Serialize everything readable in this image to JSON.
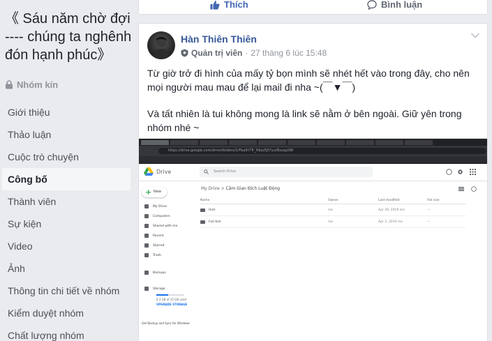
{
  "sidebar": {
    "group_title": "《 Sáu năm chờ đợi ---- chúng ta nghênh đón hạnh phúc》",
    "privacy": "Nhóm kín",
    "nav": [
      {
        "label": "Giới thiệu",
        "active": false
      },
      {
        "label": "Thảo luận",
        "active": false
      },
      {
        "label": "Cuộc trò chuyện",
        "active": false
      },
      {
        "label": "Công bố",
        "active": true
      },
      {
        "label": "Thành viên",
        "active": false
      },
      {
        "label": "Sự kiện",
        "active": false
      },
      {
        "label": "Video",
        "active": false
      },
      {
        "label": "Ảnh",
        "active": false
      },
      {
        "label": "Thông tin chi tiết về nhóm",
        "active": false
      },
      {
        "label": "Kiểm duyệt nhóm",
        "active": false
      },
      {
        "label": "Chất lượng nhóm",
        "active": false
      }
    ]
  },
  "top_card": {
    "like_label": "Thích",
    "comment_label": "Bình luận"
  },
  "post": {
    "author": "Hàn Thiên Thiên",
    "role": "Quản trị viên",
    "separator": "·",
    "timestamp": "27 tháng 6 lúc 15:48",
    "paragraphs": [
      "Từ giờ trở đi hình của mấy tỷ bọn mình sẽ nhét hết vào trong đây, cho nên mọi người mau mau để lại mail đi nha ~(￣▼￣)",
      "Và tất nhiên là tui không mong là link sẽ nằm ở bên ngoài. Giữ yên trong nhóm nhé ~"
    ]
  },
  "embedded_drive": {
    "url": "https://drive.google.com/drive/folders/1rFba5t7Tr_Hbsz5Jt7yurBsuqytWi",
    "app_name": "Drive",
    "search_placeholder": "Search Drive",
    "new_label": "New",
    "side_items": [
      "My Drive",
      "Computers",
      "Shared with me",
      "Recent",
      "Starred",
      "Trash",
      "Backups",
      "Storage"
    ],
    "storage_text": "6.3 GB of 15 GB used",
    "storage_fraction": 0.42,
    "upgrade_label": "UPGRADE STORAGE",
    "backup_text": "Get Backup and Sync for Windows",
    "breadcrumb_root": "My Drive",
    "breadcrumb_sep": ">",
    "breadcrumb_current": "Cấm Gian Đích Luật Động",
    "columns": {
      "name": "Name",
      "owner": "Owner",
      "modified": "Last modified",
      "size": "File size"
    },
    "files": [
      {
        "name": "Hint",
        "owner": "me",
        "modified": "Apr 29, 2019 me",
        "size": "—"
      },
      {
        "name": "Full ảnh",
        "owner": "me",
        "modified": "Apr 2, 2019 me",
        "size": "—"
      }
    ]
  },
  "colors": {
    "link": "#365899",
    "accent": "#4267b2",
    "background": "#e9ebee"
  }
}
